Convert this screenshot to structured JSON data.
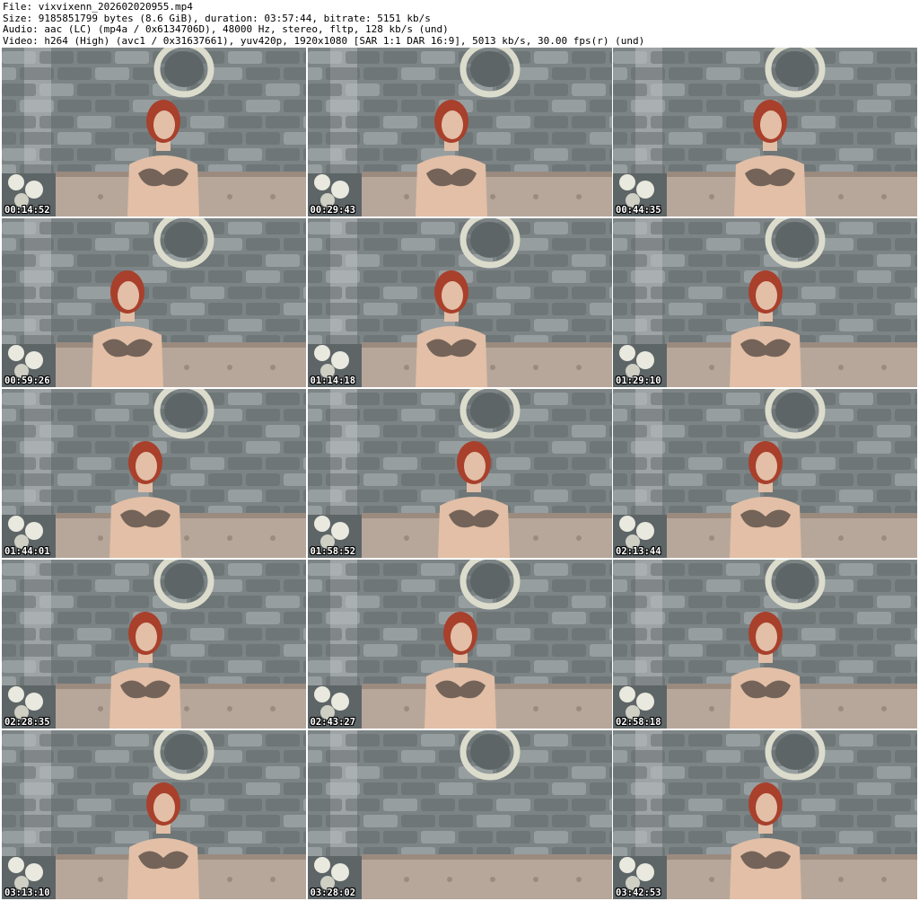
{
  "header": {
    "file": "File: vixvixenn_202602020955.mp4",
    "size": "Size: 9185851799 bytes (8.6 GiB), duration: 03:57:44, bitrate: 5151 kb/s",
    "audio": "Audio: aac (LC) (mp4a / 0x6134706D), 48000 Hz, stereo, fltp, 128 kb/s (und)",
    "video": "Video: h264 (High) (avc1 / 0x31637661), yuv420p, 1920x1080 [SAR 1:1 DAR 16:9], 5013 kb/s, 30.00 fps(r) (und)"
  },
  "thumbnails": [
    {
      "timestamp": "00:14:52"
    },
    {
      "timestamp": "00:29:43"
    },
    {
      "timestamp": "00:44:35"
    },
    {
      "timestamp": "00:59:26"
    },
    {
      "timestamp": "01:14:18"
    },
    {
      "timestamp": "01:29:10"
    },
    {
      "timestamp": "01:44:01"
    },
    {
      "timestamp": "01:58:52"
    },
    {
      "timestamp": "02:13:44"
    },
    {
      "timestamp": "02:28:35"
    },
    {
      "timestamp": "02:43:27"
    },
    {
      "timestamp": "02:58:18"
    },
    {
      "timestamp": "03:13:10"
    },
    {
      "timestamp": "03:28:02"
    },
    {
      "timestamp": "03:42:53"
    }
  ],
  "colors": {
    "wall": "#7d8486",
    "wall_dark": "#5e6567",
    "brick_light": "#b9bec0",
    "sofa": "#b7a79a",
    "sofa_dark": "#9b8b7f",
    "hair": "#a8402c",
    "skin": "#e2bfa6",
    "lingerie": "#2b2624",
    "frame": "#dcdccd",
    "flowers": "#e9e9df",
    "timestamp_text": "#ffffff"
  }
}
